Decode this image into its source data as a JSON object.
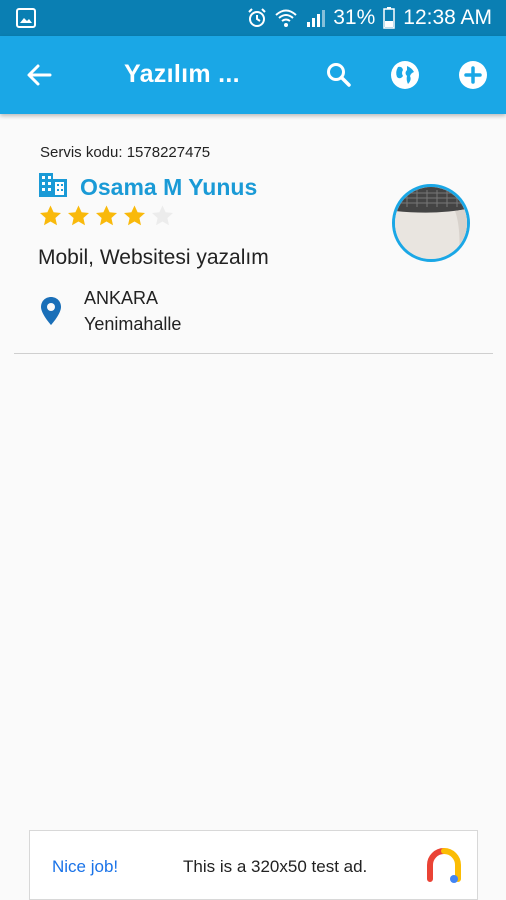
{
  "status_bar": {
    "battery": "31%",
    "time": "12:38 AM",
    "icons": [
      "gallery-icon",
      "alarm-icon",
      "wifi-icon",
      "signal-icon",
      "battery-icon"
    ]
  },
  "app_bar": {
    "title": "Yazılım ...",
    "icons": [
      "back-arrow-icon",
      "search-icon",
      "globe-icon",
      "add-icon"
    ],
    "color": "#1aa7e6"
  },
  "listing": {
    "service_code": "Servis kodu: 1578227475",
    "name": "Osama M Yunus",
    "rating": 4,
    "rating_max": 5,
    "category": "Mobil, Websitesi yazalım",
    "city": "ANKARA",
    "district": "Yenimahalle",
    "accent_color": "#1a9ad6",
    "star_color": "#f9b90b"
  },
  "ad": {
    "nice": "Nice job!",
    "text": "This is a 320x50 test ad."
  }
}
